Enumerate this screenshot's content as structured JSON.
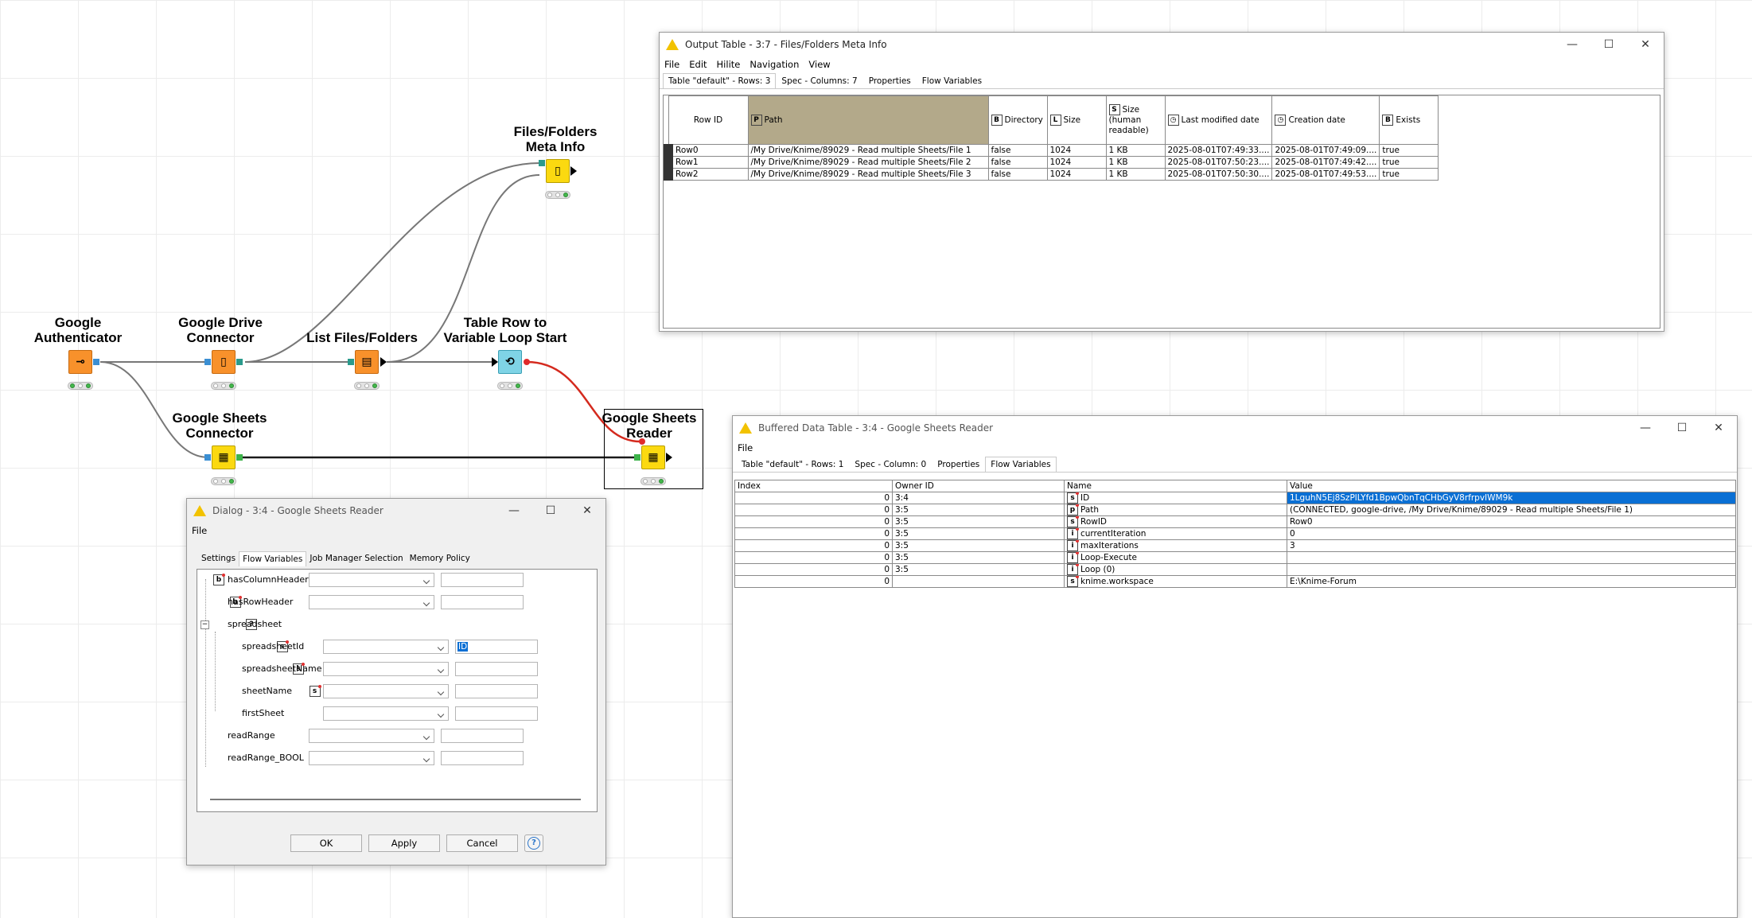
{
  "workflow": {
    "nodes": [
      {
        "id": "google-authenticator",
        "label": "Google\nAuthenticator"
      },
      {
        "id": "google-drive-connector",
        "label": "Google Drive\nConnector"
      },
      {
        "id": "list-files-folders",
        "label": "List Files/Folders"
      },
      {
        "id": "table-row-to-variable-loop-start",
        "label": "Table Row to\nVariable Loop Start"
      },
      {
        "id": "files-folders-meta-info",
        "label": "Files/Folders\nMeta Info"
      },
      {
        "id": "google-sheets-connector",
        "label": "Google Sheets\nConnector"
      },
      {
        "id": "google-sheets-reader",
        "label": "Google Sheets\nReader"
      }
    ]
  },
  "output_table": {
    "title": "Output Table - 3:7 - Files/Folders Meta Info",
    "menu": [
      "File",
      "Edit",
      "Hilite",
      "Navigation",
      "View"
    ],
    "tabs": [
      "Table \"default\" - Rows: 3",
      "Spec - Columns: 7",
      "Properties",
      "Flow Variables"
    ],
    "columns": [
      {
        "label": "Row ID",
        "type": ""
      },
      {
        "label": "Path",
        "type": "P"
      },
      {
        "label": "Directory",
        "type": "B"
      },
      {
        "label": "Size",
        "type": "L"
      },
      {
        "label": "Size (human readable)",
        "type": "S"
      },
      {
        "label": "Last modified date",
        "type": "date"
      },
      {
        "label": "Creation date",
        "type": "date"
      },
      {
        "label": "Exists",
        "type": "B"
      }
    ],
    "rows": [
      [
        "Row0",
        "/My Drive/Knime/89029 - Read multiple Sheets/File 1",
        "false",
        "1024",
        "1 KB",
        "2025-08-01T07:49:33....",
        "2025-08-01T07:49:09....",
        "true"
      ],
      [
        "Row1",
        "/My Drive/Knime/89029 - Read multiple Sheets/File 2",
        "false",
        "1024",
        "1 KB",
        "2025-08-01T07:50:23....",
        "2025-08-01T07:49:42....",
        "true"
      ],
      [
        "Row2",
        "/My Drive/Knime/89029 - Read multiple Sheets/File 3",
        "false",
        "1024",
        "1 KB",
        "2025-08-01T07:50:30....",
        "2025-08-01T07:49:53....",
        "true"
      ]
    ]
  },
  "buffered_table": {
    "title": "Buffered Data Table - 3:4 - Google Sheets Reader",
    "menu": [
      "File"
    ],
    "tabs": [
      "Table \"default\" - Rows: 1",
      "Spec - Column: 0",
      "Properties",
      "Flow Variables"
    ],
    "columns": [
      "Index",
      "Owner ID",
      "Name",
      "Value"
    ],
    "rows": [
      {
        "index": "0",
        "owner": "3:4",
        "type": "s",
        "name": "ID",
        "value": "1LguhN5Ej8SzPlLYfd1BpwQbnTqCHbGyV8rfrpvIWM9k",
        "selected": true
      },
      {
        "index": "0",
        "owner": "3:5",
        "type": "p",
        "name": "Path",
        "value": "(CONNECTED, google-drive, /My Drive/Knime/89029 - Read multiple Sheets/File 1)"
      },
      {
        "index": "0",
        "owner": "3:5",
        "type": "s",
        "name": "RowID",
        "value": "Row0"
      },
      {
        "index": "0",
        "owner": "3:5",
        "type": "i",
        "name": "currentIteration",
        "value": "0"
      },
      {
        "index": "0",
        "owner": "3:5",
        "type": "i",
        "name": "maxIterations",
        "value": "3"
      },
      {
        "index": "0",
        "owner": "3:5",
        "type": "i",
        "name": "Loop-Execute",
        "value": ""
      },
      {
        "index": "0",
        "owner": "3:5",
        "type": "i",
        "name": "Loop (0)",
        "value": ""
      },
      {
        "index": "0",
        "owner": "",
        "type": "s",
        "name": "knime.workspace",
        "value": "E:\\Knime-Forum"
      }
    ]
  },
  "dialog": {
    "title": "Dialog - 3:4 - Google Sheets Reader",
    "menu": [
      "File"
    ],
    "tabs": [
      "Settings",
      "Flow Variables",
      "Job Manager Selection",
      "Memory Policy"
    ],
    "variables": [
      {
        "name": "hasColumnHeader",
        "type": "b",
        "level": 0,
        "value": ""
      },
      {
        "name": "hasRowHeader",
        "type": "b",
        "level": 0,
        "value": ""
      },
      {
        "name": "spreadsheet",
        "type": "?",
        "level": 0,
        "group": true
      },
      {
        "name": "spreadsheetId",
        "type": "s",
        "level": 1,
        "value": "ID"
      },
      {
        "name": "spreadsheetName",
        "type": "s",
        "level": 1,
        "value": ""
      },
      {
        "name": "sheetName",
        "type": "s",
        "level": 1,
        "value": ""
      },
      {
        "name": "firstSheet",
        "type": "b",
        "level": 1,
        "value": ""
      },
      {
        "name": "readRange",
        "type": "s",
        "level": 0,
        "value": ""
      },
      {
        "name": "readRange_BOOL",
        "type": "b",
        "level": 0,
        "value": ""
      }
    ],
    "buttons": {
      "ok": "OK",
      "apply": "Apply",
      "cancel": "Cancel",
      "help": "?"
    }
  }
}
